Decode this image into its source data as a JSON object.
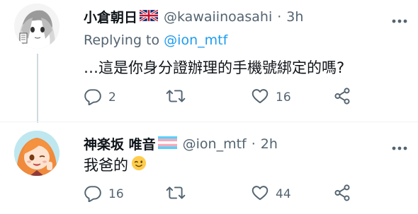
{
  "tweets": [
    {
      "display_name": "小倉朝日",
      "name_flag": "uk-flag",
      "handle": "@kawaiinoasahi",
      "separator": "·",
      "time": "3h",
      "replying_to_prefix": "Replying to",
      "replying_to_handle": "@ion_mtf",
      "text": "…這是你身分證辦理的手機號綁定的嗎?",
      "actions": {
        "reply_count": "2",
        "retweet_count": "",
        "like_count": "16"
      }
    },
    {
      "display_name": "神楽坂 唯音",
      "name_flag": "transgender-flag",
      "handle": "@ion_mtf",
      "separator": "·",
      "time": "2h",
      "text": "我爸的",
      "text_emoji": "winking-face-emoji",
      "actions": {
        "reply_count": "16",
        "retweet_count": "",
        "like_count": "44"
      }
    }
  ],
  "icons": {
    "more": "more-icon",
    "reply": "reply-icon",
    "retweet": "retweet-icon",
    "like": "heart-icon",
    "share": "share-icon"
  },
  "colors": {
    "text": "#0f1419",
    "secondary": "#536471",
    "mention": "#1d9bf0",
    "divider": "#eff3f4",
    "thread_line": "#cfd9de"
  }
}
